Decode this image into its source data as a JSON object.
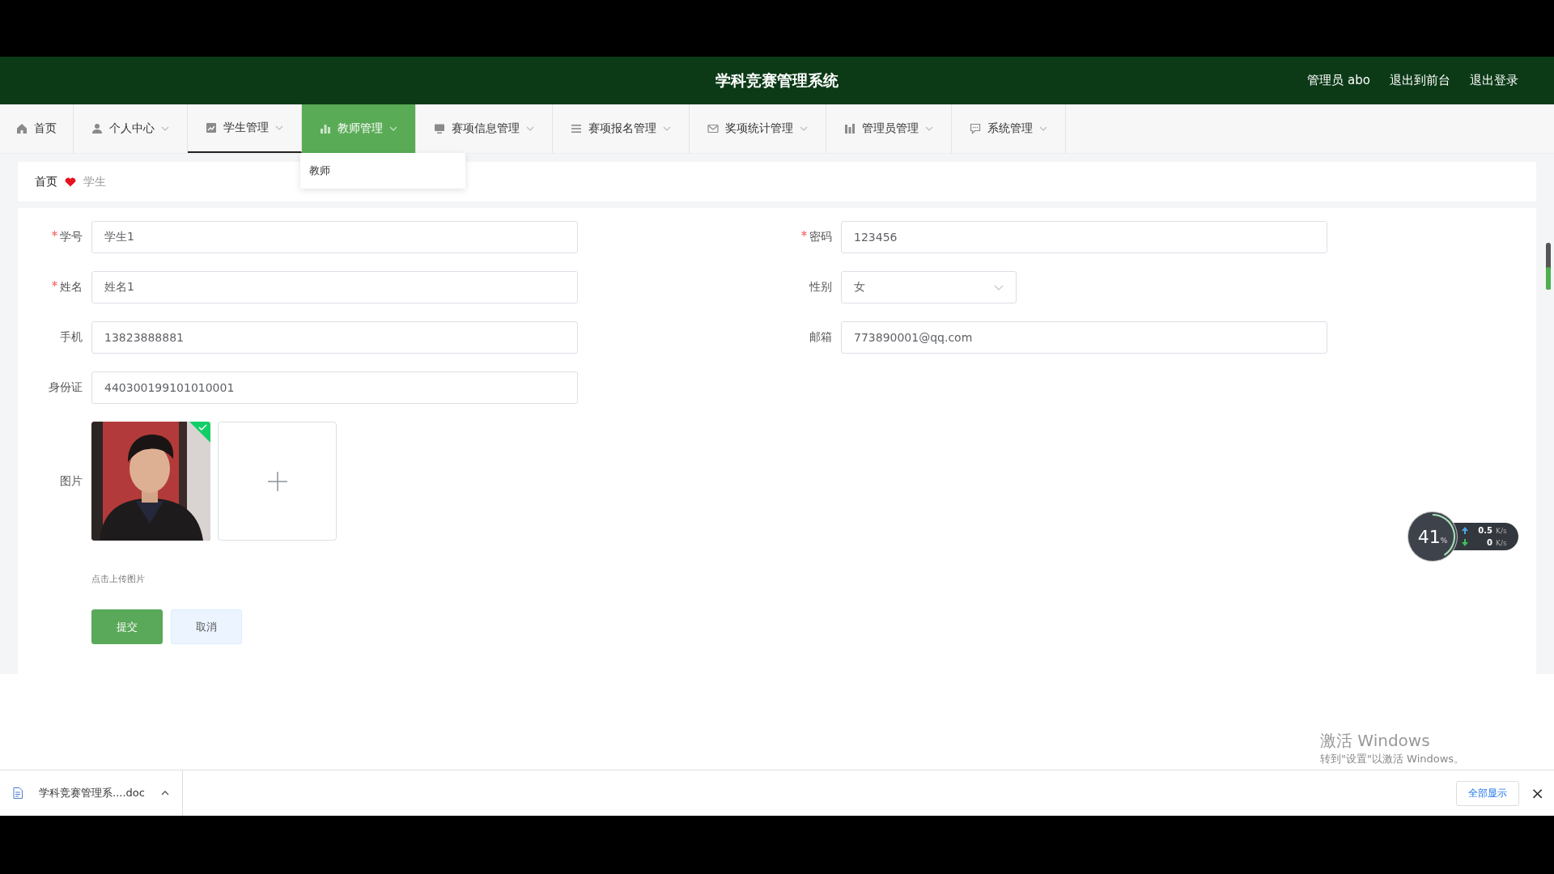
{
  "header": {
    "title": "学科竞赛管理系统",
    "links": [
      "管理员 abo",
      "退出到前台",
      "退出登录"
    ]
  },
  "nav": [
    {
      "label": "首页",
      "has_menu": false,
      "selected": false,
      "highlighted": false
    },
    {
      "label": "个人中心",
      "has_menu": true,
      "selected": false,
      "highlighted": false
    },
    {
      "label": "学生管理",
      "has_menu": true,
      "selected": true,
      "highlighted": false
    },
    {
      "label": "教师管理",
      "has_menu": true,
      "selected": false,
      "highlighted": true
    },
    {
      "label": "赛项信息管理",
      "has_menu": true,
      "selected": false,
      "highlighted": false
    },
    {
      "label": "赛项报名管理",
      "has_menu": true,
      "selected": false,
      "highlighted": false
    },
    {
      "label": "奖项统计管理",
      "has_menu": true,
      "selected": false,
      "highlighted": false
    },
    {
      "label": "管理员管理",
      "has_menu": true,
      "selected": false,
      "highlighted": false
    },
    {
      "label": "系统管理",
      "has_menu": true,
      "selected": false,
      "highlighted": false
    }
  ],
  "dropdown": {
    "items": [
      "教师"
    ]
  },
  "breadcrumb": [
    "首页",
    "学生"
  ],
  "form": {
    "left": [
      {
        "kind": "input",
        "label": "学号",
        "value": "学生1",
        "required": true
      },
      {
        "kind": "input",
        "label": "姓名",
        "value": "姓名1",
        "required": true
      },
      {
        "kind": "input",
        "label": "手机",
        "value": "13823888881",
        "required": false
      },
      {
        "kind": "input",
        "label": "身份证",
        "value": "440300199101010001",
        "required": false
      },
      {
        "kind": "upload",
        "label": "图片",
        "required": false,
        "uploaded": true,
        "hint": "点击上传图片"
      }
    ],
    "right": [
      {
        "kind": "input",
        "label": "密码",
        "value": "123456",
        "required": true
      },
      {
        "kind": "select",
        "label": "性别",
        "value": "女",
        "required": false
      },
      {
        "kind": "input",
        "label": "邮箱",
        "value": "773890001@qq.com",
        "required": false
      }
    ],
    "buttons": [
      {
        "kind": "primary",
        "label": "提交"
      },
      {
        "kind": "plain",
        "label": "取消"
      }
    ]
  },
  "speed_widget": {
    "percent": "41",
    "unit": "%",
    "level": 0.41,
    "up": "0.5",
    "up_unit": "K/s",
    "down": "0",
    "down_unit": "K/s"
  },
  "watermark": {
    "title": "激活 Windows",
    "subtitle": "转到\"设置\"以激活 Windows。"
  },
  "download_bar": {
    "file": "学科竞赛管理系....doc",
    "show_all": "全部显示",
    "close": "×"
  }
}
